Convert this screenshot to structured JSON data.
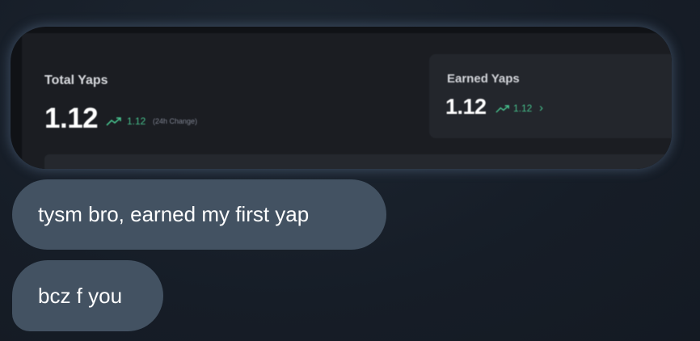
{
  "attachment": {
    "total_title": "Total Yaps",
    "total_value": "1.12",
    "total_change": "1.12",
    "total_change_label": "(24h Change)",
    "earned_title": "Earned Yaps",
    "earned_value": "1.12",
    "earned_change": "1.12",
    "chevron": "›"
  },
  "messages": [
    {
      "text": "tysm bro, earned my first yap"
    },
    {
      "text": "bcz f you"
    }
  ],
  "colors": {
    "background": "#161d27",
    "bubble": "#435262",
    "trend_green": "#46c08c",
    "card_bg": "#1b1d22"
  },
  "icons": [
    "trend-up-icon",
    "chevron-right-icon"
  ]
}
